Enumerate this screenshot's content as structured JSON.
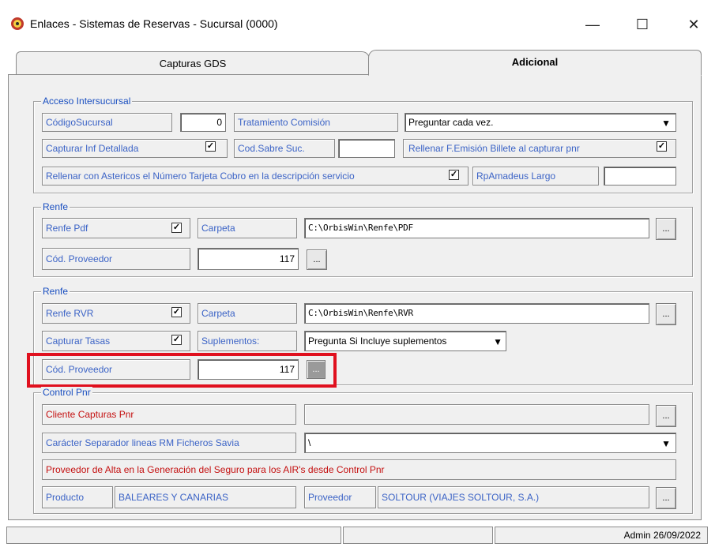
{
  "window": {
    "title": "Enlaces - Sistemas de Reservas - Sucursal (0000)",
    "minimize": "—",
    "maximize": "☐",
    "close": "✕"
  },
  "tabs": [
    {
      "label": "Capturas GDS",
      "active": false
    },
    {
      "label": "Adicional",
      "active": true
    }
  ],
  "acceso": {
    "legend": "Acceso Intersucursal",
    "codigo_sucursal_label": "CódigoSucursal",
    "codigo_sucursal_value": "0",
    "tratamiento_label": "Tratamiento Comisión",
    "tratamiento_value": "Preguntar cada vez.",
    "capturar_inf_label": "Capturar Inf Detallada",
    "capturar_inf_checked": true,
    "cod_sabre_label": "Cod.Sabre Suc.",
    "cod_sabre_value": "",
    "rellenar_femision_label": "Rellenar F.Emisión Billete al capturar pnr",
    "rellenar_femision_checked": true,
    "rellenar_asteriscos_label": "Rellenar con Astericos el Número Tarjeta Cobro en la descripción servicio",
    "rellenar_asteriscos_checked": true,
    "rpamadeus_label": "RpAmadeus Largo",
    "rpamadeus_value": ""
  },
  "renfe1": {
    "legend": "Renfe",
    "pdf_label": "Renfe Pdf",
    "pdf_checked": true,
    "carpeta_label": "Carpeta",
    "carpeta_value": "C:\\OrbisWin\\Renfe\\PDF",
    "proveedor_label": "Cód. Proveedor",
    "proveedor_value": "117",
    "browse": "..."
  },
  "renfe2": {
    "legend": "Renfe",
    "rvr_label": "Renfe RVR",
    "rvr_checked": true,
    "carpeta_label": "Carpeta",
    "carpeta_value": "C:\\OrbisWin\\Renfe\\RVR",
    "tasas_label": "Capturar Tasas",
    "tasas_checked": true,
    "suplementos_label": "Suplementos:",
    "suplementos_value": "Pregunta Si Incluye suplementos",
    "proveedor_label": "Cód. Proveedor",
    "proveedor_value": "117",
    "browse": "..."
  },
  "control_pnr": {
    "legend": "Control Pnr",
    "cliente_label": "Cliente Capturas Pnr",
    "cliente_value": "",
    "separador_label": "Carácter Separador lineas RM Ficheros Savia",
    "separador_value": "\\",
    "proveedor_alta_label": "Proveedor de Alta en la Generación del Seguro para los AIR's desde Control Pnr",
    "producto_label": "Producto",
    "producto_value": "BALEARES Y CANARIAS",
    "proveedor_label": "Proveedor",
    "proveedor_value": "SOLTOUR (VIAJES SOLTOUR, S.A.)",
    "browse": "..."
  },
  "status": {
    "cell1": "",
    "cell2": "",
    "user_date": "Admin 26/09/2022"
  },
  "colors": {
    "label_blue": "#3b63c6",
    "label_red": "#c41010",
    "highlight": "#e0101e"
  }
}
